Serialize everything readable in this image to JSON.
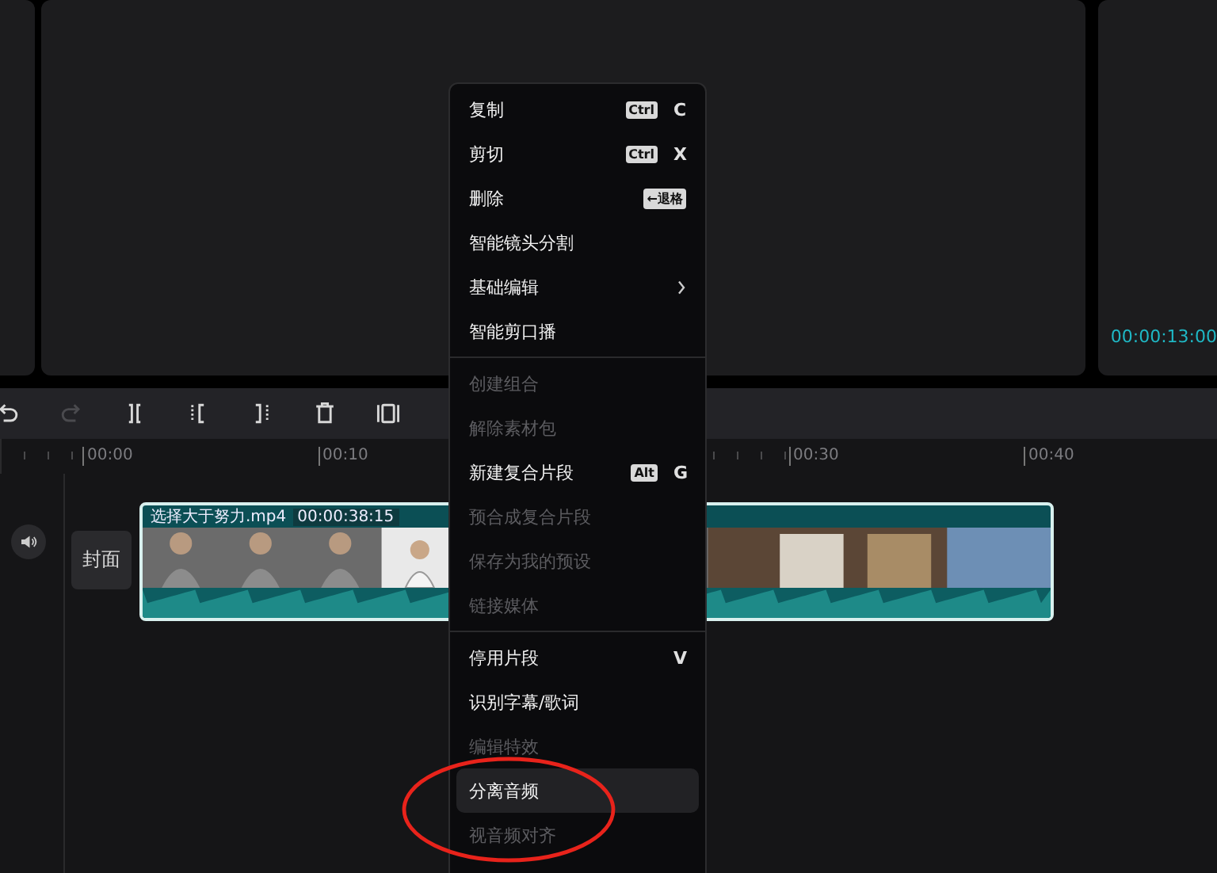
{
  "preview": {
    "timecode": "00:00:13:00"
  },
  "toolbar": [
    {
      "kind": "undo",
      "disabled": false
    },
    {
      "kind": "redo",
      "disabled": true
    },
    {
      "kind": "split",
      "disabled": false
    },
    {
      "kind": "split-left",
      "disabled": false
    },
    {
      "kind": "split-right",
      "disabled": false
    },
    {
      "kind": "delete",
      "disabled": false
    },
    {
      "kind": "freeze",
      "disabled": false
    }
  ],
  "ruler": [
    {
      "label": "00:00"
    },
    {
      "label": "00:10"
    },
    {
      "label": "00:30"
    },
    {
      "label": "00:40"
    }
  ],
  "track": {
    "cover_label": "封面",
    "clip": {
      "name": "选择大于努力.mp4",
      "duration": "00:00:38:15"
    }
  },
  "context_menu": [
    {
      "kind": "item",
      "label": "复制",
      "badge": "Ctrl",
      "key": "C",
      "disabled": false,
      "submenu": false,
      "selected": false
    },
    {
      "kind": "item",
      "label": "剪切",
      "badge": "Ctrl",
      "key": "X",
      "disabled": false,
      "submenu": false,
      "selected": false
    },
    {
      "kind": "item",
      "label": "删除",
      "badge": "←退格",
      "disabled": false,
      "submenu": false,
      "selected": false
    },
    {
      "kind": "item",
      "label": "智能镜头分割",
      "disabled": false,
      "submenu": false,
      "selected": false
    },
    {
      "kind": "item",
      "label": "基础编辑",
      "disabled": false,
      "submenu": true,
      "selected": false
    },
    {
      "kind": "item",
      "label": "智能剪口播",
      "disabled": false,
      "submenu": false,
      "selected": false
    },
    {
      "kind": "divider"
    },
    {
      "kind": "item",
      "label": "创建组合",
      "disabled": true,
      "submenu": false,
      "selected": false
    },
    {
      "kind": "item",
      "label": "解除素材包",
      "disabled": true,
      "submenu": false,
      "selected": false
    },
    {
      "kind": "item",
      "label": "新建复合片段",
      "badge": "Alt",
      "key": "G",
      "disabled": false,
      "submenu": false,
      "selected": false
    },
    {
      "kind": "item",
      "label": "预合成复合片段",
      "disabled": true,
      "submenu": false,
      "selected": false
    },
    {
      "kind": "item",
      "label": "保存为我的预设",
      "disabled": true,
      "submenu": false,
      "selected": false
    },
    {
      "kind": "item",
      "label": "链接媒体",
      "disabled": true,
      "submenu": false,
      "selected": false
    },
    {
      "kind": "divider"
    },
    {
      "kind": "item",
      "label": "停用片段",
      "key": "V",
      "disabled": false,
      "submenu": false,
      "selected": false
    },
    {
      "kind": "item",
      "label": "识别字幕/歌词",
      "disabled": false,
      "submenu": false,
      "selected": false
    },
    {
      "kind": "item",
      "label": "编辑特效",
      "disabled": true,
      "submenu": false,
      "selected": false
    },
    {
      "kind": "item",
      "label": "分离音频",
      "disabled": false,
      "submenu": false,
      "selected": true
    },
    {
      "kind": "item",
      "label": "视音频对齐",
      "disabled": true,
      "submenu": false,
      "selected": false
    }
  ],
  "annotation": {
    "kind": "ellipse"
  }
}
